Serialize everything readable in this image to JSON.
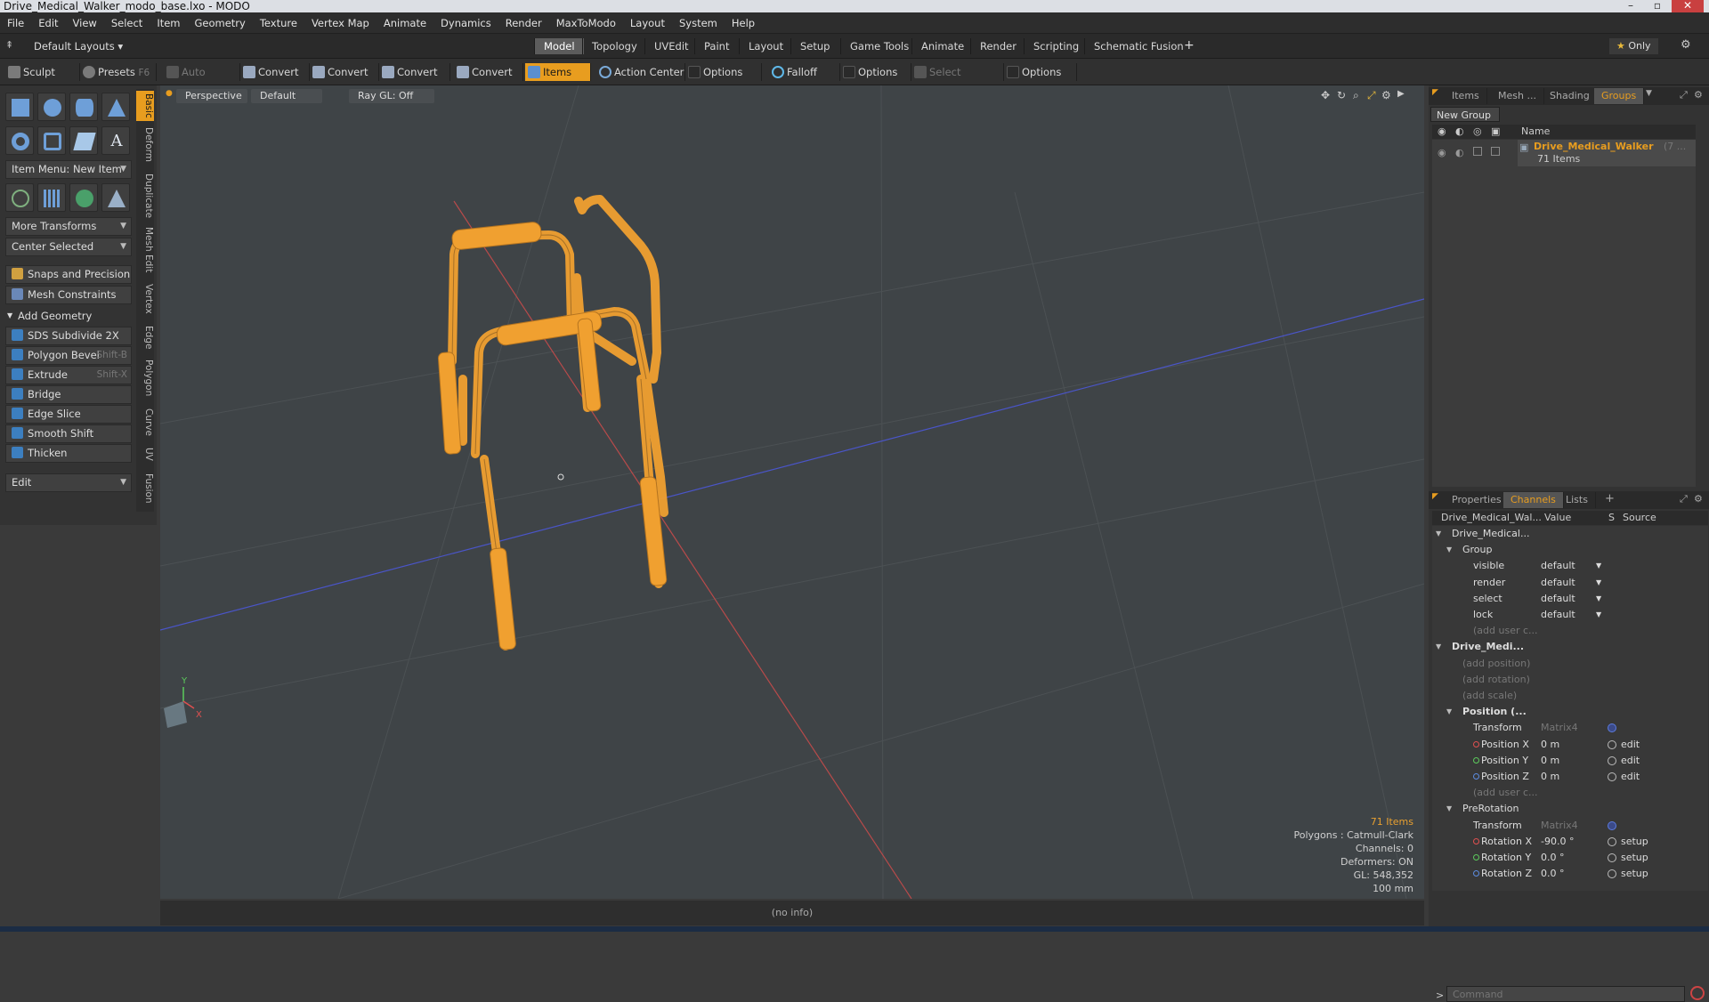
{
  "window": {
    "title": "Drive_Medical_Walker_modo_base.lxo - MODO"
  },
  "menu": [
    "File",
    "Edit",
    "View",
    "Select",
    "Item",
    "Geometry",
    "Texture",
    "Vertex Map",
    "Animate",
    "Dynamics",
    "Render",
    "MaxToModo",
    "Layout",
    "System",
    "Help"
  ],
  "layout": {
    "preset": "Default Layouts",
    "tabs": [
      "Model",
      "Topology",
      "UVEdit",
      "Paint",
      "Layout",
      "Setup",
      "Game Tools",
      "Animate",
      "Render",
      "Scripting",
      "Schematic Fusion"
    ],
    "add": "+",
    "only": "Only"
  },
  "toolbar": {
    "sculpt": "Sculpt",
    "presets": "Presets",
    "presets_key": "F6",
    "auto_select": "Auto Select",
    "convert": "Convert",
    "items": "Items",
    "action_center": "Action Center",
    "options": "Options",
    "falloff": "Falloff",
    "select_through": "Select Through"
  },
  "left_panel": {
    "item_menu": "Item Menu: New Item",
    "more_transforms": "More Transforms",
    "center_selected": "Center Selected",
    "snaps": "Snaps and Precision",
    "mesh_constraints": "Mesh Constraints",
    "add_geometry": "Add Geometry",
    "tools": [
      {
        "label": "SDS Subdivide 2X",
        "key": ""
      },
      {
        "label": "Polygon Bevel",
        "key": "Shift-B"
      },
      {
        "label": "Extrude",
        "key": "Shift-X"
      },
      {
        "label": "Bridge",
        "key": ""
      },
      {
        "label": "Edge Slice",
        "key": ""
      },
      {
        "label": "Smooth Shift",
        "key": ""
      },
      {
        "label": "Thicken",
        "key": ""
      }
    ],
    "edit": "Edit"
  },
  "side_tabs": [
    "Basic",
    "Deform",
    "Duplicate",
    "Mesh Edit",
    "Vertex",
    "Edge",
    "Polygon",
    "Curve",
    "UV",
    "Fusion"
  ],
  "viewport": {
    "view": "Perspective",
    "style": "Default",
    "raygl": "Ray GL: Off",
    "status": {
      "items": "71 Items",
      "polygons": "Polygons : Catmull-Clark",
      "channels": "Channels: 0",
      "deformers": "Deformers: ON",
      "gl": "GL: 548,352",
      "scale": "100 mm"
    },
    "axis_y": "Y",
    "axis_x": "X"
  },
  "infobar": "(no info)",
  "groups_panel": {
    "tabs": [
      "Items",
      "Mesh ...",
      "Shading",
      "Groups"
    ],
    "new_group": "New Group",
    "col_name": "Name",
    "group_name": "Drive_Medical_Walker",
    "group_suffix": "(7 ...",
    "group_count": "71 Items"
  },
  "channels_panel": {
    "tabs": [
      "Properties",
      "Channels",
      "Lists"
    ],
    "add": "+",
    "col_item": "Drive_Medical_Wal...",
    "col_value": "Value",
    "col_s": "S",
    "col_source": "Source",
    "rows": [
      {
        "name": "Drive_Medical...",
        "value": "",
        "source": "",
        "indent": 1,
        "tri": "▼",
        "bold": false
      },
      {
        "name": "Group",
        "value": "",
        "source": "",
        "indent": 2,
        "tri": "▼",
        "bold": false
      },
      {
        "name": "visible",
        "value": "default",
        "source": "",
        "indent": 3,
        "tri": "",
        "bold": false,
        "dd": true
      },
      {
        "name": "render",
        "value": "default",
        "source": "",
        "indent": 3,
        "tri": "",
        "bold": false,
        "dd": true
      },
      {
        "name": "select",
        "value": "default",
        "source": "",
        "indent": 3,
        "tri": "",
        "bold": false,
        "dd": true
      },
      {
        "name": "lock",
        "value": "default",
        "source": "",
        "indent": 3,
        "tri": "",
        "bold": false,
        "dd": true
      },
      {
        "name": "(add user c...",
        "value": "",
        "source": "",
        "indent": 3,
        "tri": "",
        "dim": true
      },
      {
        "name": "Drive_Medi...",
        "value": "",
        "source": "",
        "indent": 1,
        "tri": "▼",
        "bold": true
      },
      {
        "name": "(add position)",
        "value": "",
        "source": "",
        "indent": 2,
        "tri": "",
        "dim": true
      },
      {
        "name": "(add rotation)",
        "value": "",
        "source": "",
        "indent": 2,
        "tri": "",
        "dim": true
      },
      {
        "name": "(add scale)",
        "value": "",
        "source": "",
        "indent": 2,
        "tri": "",
        "dim": true
      },
      {
        "name": "Position (...",
        "value": "",
        "source": "",
        "indent": 2,
        "tri": "▼",
        "bold": true
      },
      {
        "name": "Transform",
        "value": "Matrix4",
        "source": "",
        "indent": 3,
        "tri": "",
        "vdim": true,
        "sblue": true
      },
      {
        "name": "Position X",
        "value": "0 m",
        "source": "edit",
        "indent": 3,
        "dot": "#e05050",
        "scirc": true
      },
      {
        "name": "Position Y",
        "value": "0 m",
        "source": "edit",
        "indent": 3,
        "dot": "#5ccb5c",
        "scirc": true
      },
      {
        "name": "Position Z",
        "value": "0 m",
        "source": "edit",
        "indent": 3,
        "dot": "#5c8ce0",
        "scirc": true
      },
      {
        "name": "(add user c...",
        "value": "",
        "source": "",
        "indent": 3,
        "dim": true
      },
      {
        "name": "PreRotation",
        "value": "",
        "source": "",
        "indent": 2,
        "tri": "▼"
      },
      {
        "name": "Transform",
        "value": "Matrix4",
        "source": "",
        "indent": 3,
        "vdim": true,
        "sblue": true
      },
      {
        "name": "Rotation X",
        "value": "-90.0 °",
        "source": "setup",
        "indent": 3,
        "dot": "#e05050",
        "scirc": true
      },
      {
        "name": "Rotation Y",
        "value": "0.0 °",
        "source": "setup",
        "indent": 3,
        "dot": "#5ccb5c",
        "scirc": true
      },
      {
        "name": "Rotation Z",
        "value": "0.0 °",
        "source": "setup",
        "indent": 3,
        "dot": "#5c8ce0",
        "scirc": true
      }
    ]
  },
  "command": {
    "prompt": ">",
    "placeholder": "Command"
  },
  "colors": {
    "accent": "#e89d1f",
    "wire": "#f0a030"
  }
}
